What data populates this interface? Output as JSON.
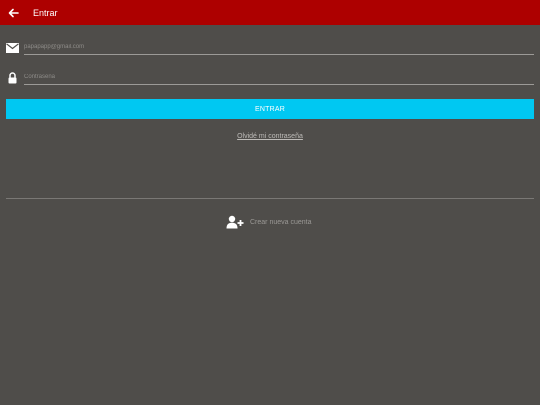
{
  "appbar": {
    "title": "Entrar",
    "back_icon": "arrow-left-icon",
    "background": "#ad0000"
  },
  "form": {
    "email": {
      "icon": "envelope-icon",
      "placeholder": "papapapp@gmail.com",
      "value": ""
    },
    "password": {
      "icon": "lock-icon",
      "placeholder": "Contraseña",
      "value": ""
    },
    "submit_label": "ENTRAR",
    "submit_color": "#00c8f2",
    "forgot_link": "Olvidé mi contraseña"
  },
  "signup": {
    "icon": "user-plus-icon",
    "label": "Crear nueva cuenta"
  }
}
